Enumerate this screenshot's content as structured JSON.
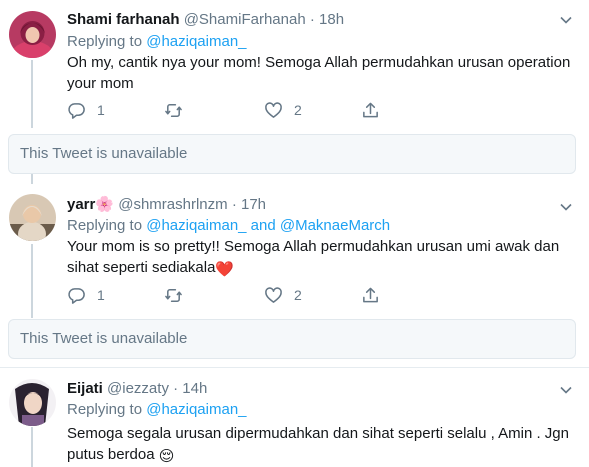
{
  "tweets": [
    {
      "name": "Shami farhanah",
      "handle": "@ShamiFarhanah",
      "dot": "·",
      "time": "18h",
      "replying_prefix": "Replying to",
      "replying_to": "@haziqaiman_",
      "text": "Oh my, cantik nya your mom! Semoga Allah permudahkan urusan operation your mom",
      "reply_count": "1",
      "retweet_count": "",
      "like_count": "2",
      "avatar_icon": "profile-photo"
    },
    {
      "name": "yarr🌸",
      "handle": "@shmrashrlnzm",
      "dot": "·",
      "time": "17h",
      "replying_prefix": "Replying to",
      "replying_to": "@haziqaiman_ and @MaknaeMarch",
      "text": "Your mom is so pretty!! Semoga Allah permudahkan urusan umi awak dan sihat seperti sediakala",
      "text_emoji": "❤️",
      "reply_count": "1",
      "retweet_count": "",
      "like_count": "2",
      "avatar_icon": "profile-photo"
    },
    {
      "name": "Eijati",
      "handle": "@iezzaty",
      "dot": "·",
      "time": "14h",
      "replying_prefix": "Replying to",
      "replying_to": "@haziqaiman_",
      "text": "Semoga segala urusan dipermudahkan dan sihat seperti selalu , Amin . Jgn putus berdoa",
      "text_emoji": "😌",
      "avatar_icon": "profile-photo"
    }
  ],
  "unavailable_label": "This Tweet is unavailable",
  "colors": {
    "link": "#1da1f2",
    "muted": "#657786",
    "text": "#14171a",
    "heart": "#e0245e",
    "thread_line": "#ccd6dd",
    "unavailable_bg": "#f5f8fa"
  }
}
